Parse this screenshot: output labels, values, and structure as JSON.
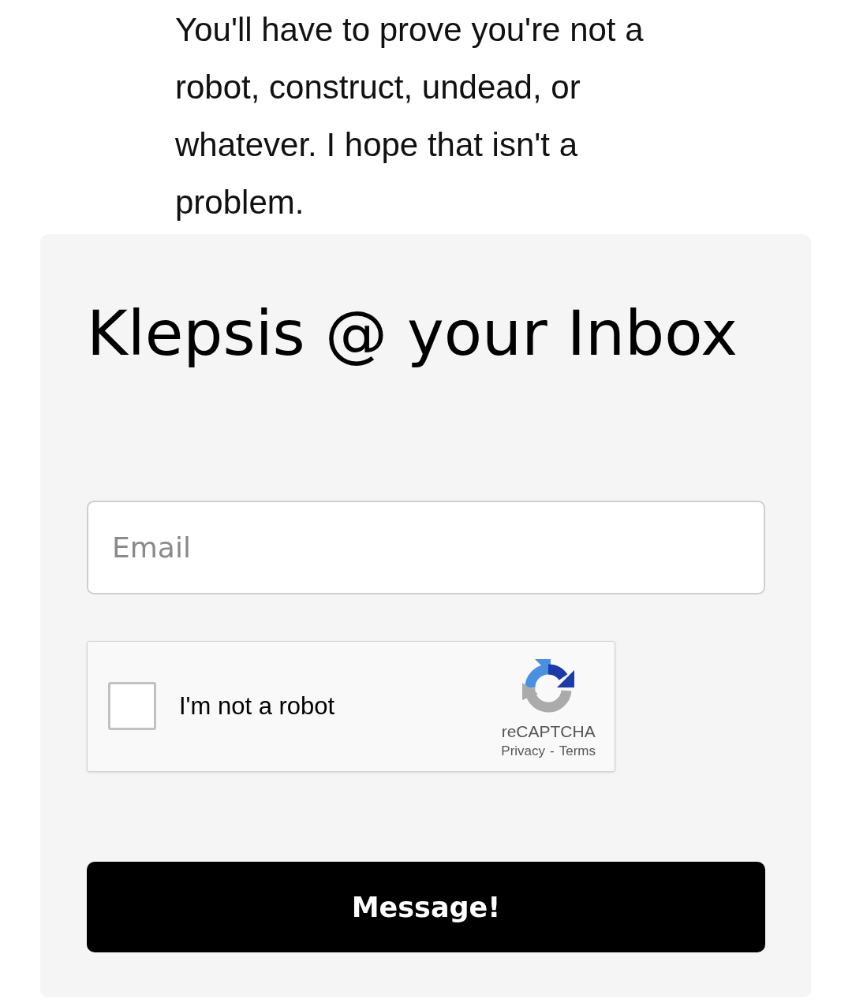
{
  "intro": {
    "text": "You'll have to prove you're not a robot, construct, undead, or whatever. I hope that isn't a problem."
  },
  "newsletter_form": {
    "title": "Klepsis @ your Inbox",
    "email_field": {
      "placeholder": "Email"
    },
    "captcha": {
      "checked": false,
      "label": "I'm not a robot",
      "brand": "reCAPTCHA",
      "links": [
        "Privacy",
        "Terms"
      ],
      "separator": "-"
    },
    "submit_button": {
      "label": "Message!"
    }
  }
}
